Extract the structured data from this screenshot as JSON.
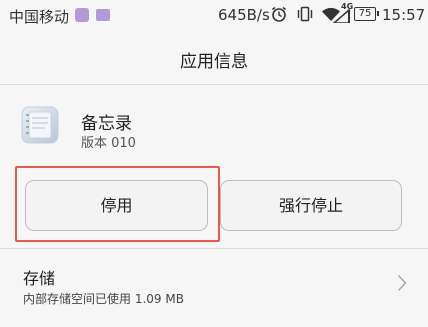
{
  "status_bar": {
    "carrier": "中国移动",
    "net_speed": "645B/s",
    "network_type": "4G",
    "battery": "75",
    "time": "15:57",
    "icons": [
      "gallery-icon",
      "keyboard-icon",
      "alarm-icon",
      "vibrate-icon",
      "wifi-icon",
      "signal-icon",
      "battery-icon"
    ]
  },
  "header": {
    "title": "应用信息"
  },
  "app": {
    "name": "备忘录",
    "version": "版本 010",
    "icon": "memo-app-icon"
  },
  "actions": {
    "disable_label": "停用",
    "force_stop_label": "强行停止"
  },
  "storage": {
    "title": "存储",
    "summary": "内部存储空间已使用 1.09 MB"
  },
  "colors": {
    "background": "#f6f6f6",
    "highlight": "#e5594f",
    "status_accent": "#b39ad6"
  }
}
